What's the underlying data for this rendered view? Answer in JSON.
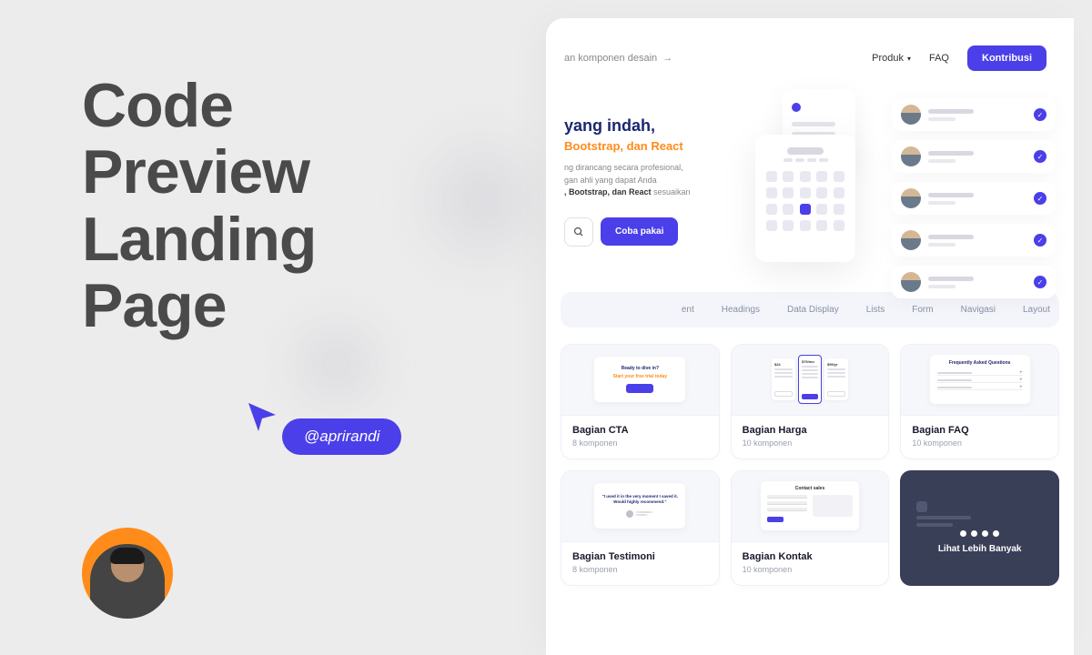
{
  "left": {
    "title_l1": "Code",
    "title_l2": "Preview",
    "title_l3": "Landing",
    "title_l4": "Page",
    "handle": "@aprirandi"
  },
  "nav": {
    "breadcrumb": "an komponen desain",
    "produk": "Produk",
    "faq": "FAQ",
    "kontribusi": "Kontribusi"
  },
  "hero": {
    "h1": "yang indah,",
    "h2": "Bootstrap, dan React",
    "p1": "ng dirancang secara profesional,",
    "p2": "gan ahli yang dapat Anda",
    "p3_bold": ", Bootstrap, dan React",
    "p3_tail": " sesuaikan",
    "try": "Coba pakai"
  },
  "tabs": {
    "t1": "ent",
    "t2": "Headings",
    "t3": "Data Display",
    "t4": "Lists",
    "t5": "Form",
    "t6": "Navigasi",
    "t7": "Layout"
  },
  "cards": {
    "cta": {
      "title": "Bagian CTA",
      "sub": "8 komponen",
      "thumb_t1": "Ready to dive in?",
      "thumb_t2": "Start your free trial today"
    },
    "harga": {
      "title": "Bagian Harga",
      "sub": "10 komponen",
      "p1": "$24",
      "p2": "$79/mo",
      "p3": "$99/yr"
    },
    "faq": {
      "title": "Bagian FAQ",
      "sub": "10 komponen",
      "thumb_h": "Frequently Asked Questions"
    },
    "testi": {
      "title": "Bagian Testimoni",
      "sub": "8 komponen",
      "quote": "\"I used it in the very moment I saved it. Would highly recommend.\""
    },
    "kontak": {
      "title": "Bagian Kontak",
      "sub": "10 komponen",
      "thumb_h": "Contact sales"
    },
    "more": "Lihat Lebih Banyak"
  }
}
